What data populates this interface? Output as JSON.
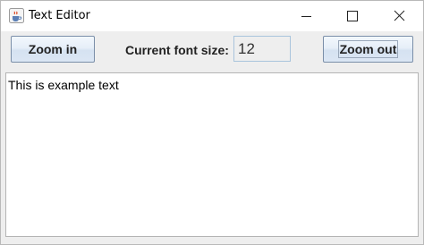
{
  "window": {
    "title": "Text Editor",
    "app_icon": "java-coffee-cup-icon"
  },
  "title_controls": {
    "minimize": "minimize-icon",
    "maximize": "maximize-icon",
    "close": "close-icon"
  },
  "toolbar": {
    "zoom_in_label": "Zoom in",
    "font_size_label": "Current font size:",
    "font_size_value": "12",
    "zoom_out_label": "Zoom out"
  },
  "editor": {
    "text": "This is example text"
  },
  "colors": {
    "panel_background": "#eeeeee",
    "button_border": "#7a8ea8",
    "field_border": "#a9c4dc"
  }
}
